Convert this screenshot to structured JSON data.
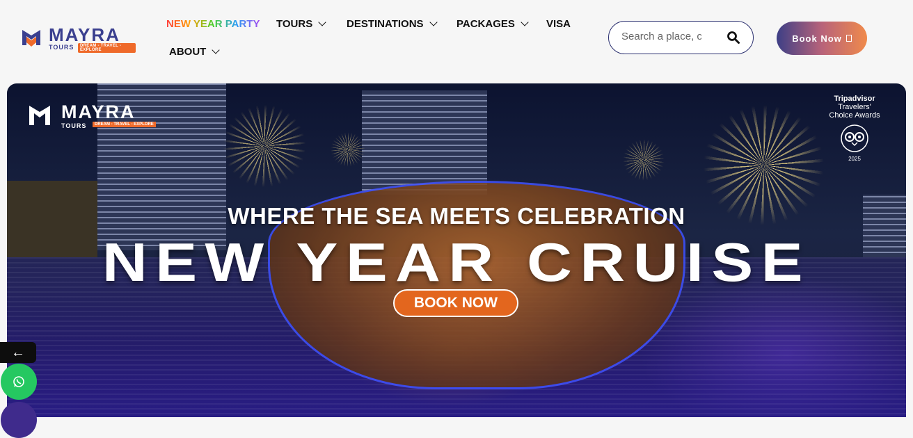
{
  "brand": {
    "name": "MAYRA",
    "sub": "TOURS",
    "tagline": "DREAM - TRAVEL - EXPLORE"
  },
  "nav": {
    "items": [
      {
        "label": "NEW YEAR PARTY"
      },
      {
        "label": "TOURS"
      },
      {
        "label": "DESTINATIONS"
      },
      {
        "label": "PACKAGES"
      },
      {
        "label": "VISA"
      },
      {
        "label": "ABOUT"
      }
    ]
  },
  "search": {
    "placeholder": "Search a place, city..."
  },
  "header_cta": {
    "label": "Book Now"
  },
  "hero": {
    "award_line1": "Tripadvisor",
    "award_line2": "Travelers'",
    "award_line3": "Choice Awards",
    "award_year": "2025",
    "tagline": "WHERE THE SEA MEETS CELEBRATION",
    "headline": "NEW YEAR CRUISE",
    "cta": "BOOK NOW"
  },
  "floating": {
    "prev_arrow": "←"
  },
  "colors": {
    "brand_navy": "#3a3f8f",
    "brand_orange": "#ef6a2a",
    "whatsapp": "#25c861"
  }
}
